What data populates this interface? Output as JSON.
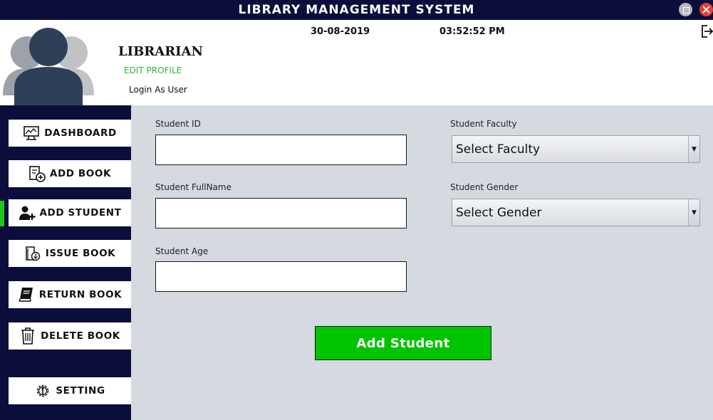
{
  "window": {
    "title": "LIBRARY MANAGEMENT SYSTEM",
    "maximize_icon": "maximize-icon",
    "close_icon": "close-icon"
  },
  "header": {
    "role": "LIBRARIAN",
    "edit_profile": "EDIT PROFILE",
    "login_as_user": "Login As User",
    "date": "30-08-2019",
    "time": "03:52:52 PM",
    "logout_icon": "logout-icon"
  },
  "sidebar": {
    "items": [
      {
        "label": "DASHBOARD",
        "icon": "dashboard-icon"
      },
      {
        "label": "ADD BOOK",
        "icon": "add-book-icon"
      },
      {
        "label": "ADD STUDENT",
        "icon": "add-student-icon",
        "active": true
      },
      {
        "label": "ISSUE BOOK",
        "icon": "issue-book-icon"
      },
      {
        "label": "RETURN BOOK",
        "icon": "return-book-icon"
      },
      {
        "label": "DELETE BOOK",
        "icon": "trash-icon"
      },
      {
        "label": "SETTING",
        "icon": "gear-icon"
      }
    ]
  },
  "form": {
    "student_id": {
      "label": "Student ID",
      "value": ""
    },
    "full_name": {
      "label": "Student FullName",
      "value": ""
    },
    "age": {
      "label": "Student Age",
      "value": ""
    },
    "faculty": {
      "label": "Student Faculty",
      "selected": "Select Faculty"
    },
    "gender": {
      "label": "Student Gender",
      "selected": "Select Gender"
    },
    "submit_label": "Add Student"
  },
  "colors": {
    "navy": "#0b0d3b",
    "accent_green": "#00c400",
    "active_marker": "#22c422",
    "content_bg": "#d5d9e0"
  }
}
